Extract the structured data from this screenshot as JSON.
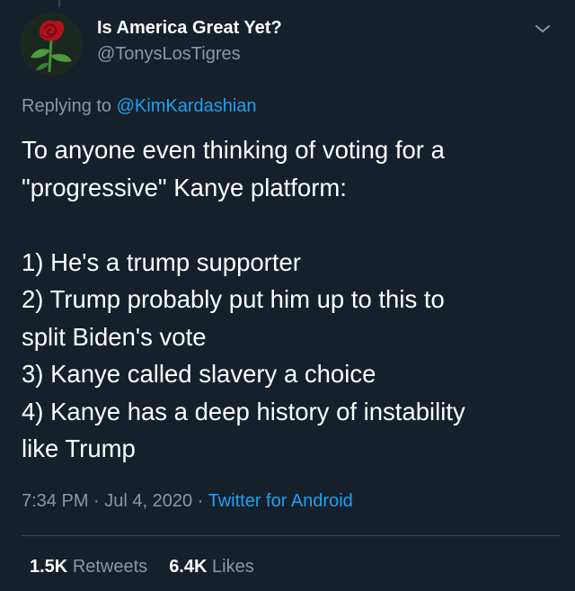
{
  "tweet": {
    "author": {
      "display_name": "Is America Great Yet?",
      "handle": "@TonysLosTigres",
      "avatar_icon": "rose-icon"
    },
    "replying_prefix": "Replying to",
    "replying_to": "@KimKardashian",
    "text": "To anyone even thinking of voting for a\n\"progressive\" Kanye platform:\n\n1) He's a trump supporter\n2) Trump probably put him up to this to\nsplit Biden's vote\n3) Kanye called slavery a choice\n4) Kanye has a deep history of instability\nlike Trump",
    "time": "7:34 PM",
    "date": "Jul 4, 2020",
    "separator": "·",
    "source": "Twitter for Android",
    "stats": {
      "retweets_count": "1.5K",
      "retweets_label": "Retweets",
      "likes_count": "6.4K",
      "likes_label": "Likes"
    },
    "menu_icon": "chevron-down-icon"
  },
  "colors": {
    "background": "#15202b",
    "text_primary": "#ffffff",
    "text_secondary": "#8899a6",
    "accent": "#1da1f2",
    "divider": "#38444d"
  }
}
